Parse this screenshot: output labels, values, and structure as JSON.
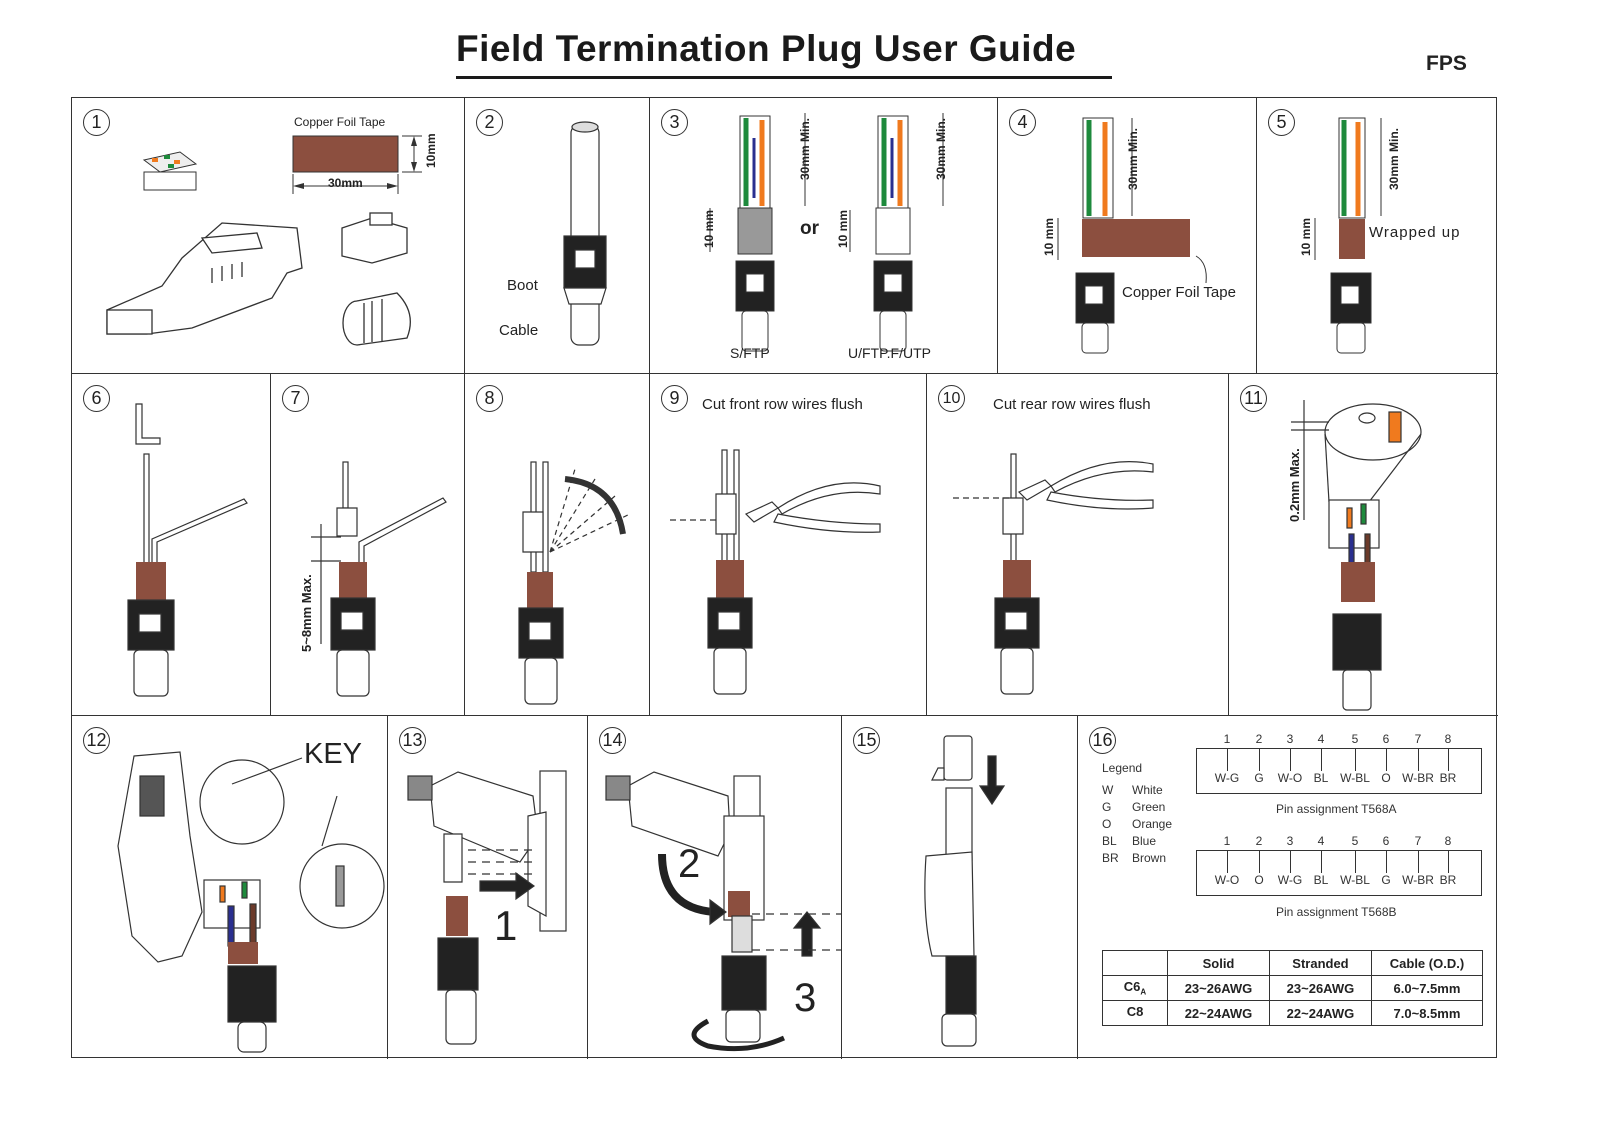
{
  "document": {
    "title": "Field Termination Plug User Guide",
    "model": "FPS"
  },
  "colors": {
    "copper_tape": "#8c4f3f",
    "wire_green": "#1e8a3c",
    "wire_orange": "#f07a1e",
    "wire_blue": "#2a2f8f",
    "wire_brown": "#6b3a2a",
    "line": "#333333"
  },
  "steps": [
    {
      "number": "1",
      "labels": {
        "tape_title": "Copper Foil Tape",
        "tape_width": "30mm",
        "tape_height": "10mm"
      }
    },
    {
      "number": "2",
      "labels": {
        "boot": "Boot",
        "cable": "Cable"
      }
    },
    {
      "number": "3",
      "labels": {
        "strip_length": "30mm Min.",
        "shield_length": "10 mm",
        "or": "or",
        "type_a": "S/FTP",
        "type_b": "U/FTP.F/UTP"
      }
    },
    {
      "number": "4",
      "labels": {
        "strip_length": "30mm Min.",
        "shield_length": "10 mm",
        "tape": "Copper Foil Tape"
      }
    },
    {
      "number": "5",
      "labels": {
        "strip_length": "30mm Min.",
        "shield_length": "10 mm",
        "note": "Wrapped up"
      }
    },
    {
      "number": "6"
    },
    {
      "number": "7",
      "labels": {
        "gap": "5~8mm Max."
      }
    },
    {
      "number": "8"
    },
    {
      "number": "9",
      "caption": "Cut front row wires flush"
    },
    {
      "number": "10",
      "caption": "Cut rear row wires flush"
    },
    {
      "number": "11",
      "labels": {
        "protrusion": "0.2mm Max."
      }
    },
    {
      "number": "12",
      "labels": {
        "key": "KEY"
      }
    },
    {
      "number": "13",
      "labels": {
        "action": "1"
      }
    },
    {
      "number": "14",
      "labels": {
        "action_a": "2",
        "action_b": "3"
      }
    },
    {
      "number": "15"
    },
    {
      "number": "16"
    }
  ],
  "legend": {
    "title": "Legend",
    "items": [
      {
        "code": "W",
        "name": "White"
      },
      {
        "code": "G",
        "name": "Green"
      },
      {
        "code": "O",
        "name": "Orange"
      },
      {
        "code": "BL",
        "name": "Blue"
      },
      {
        "code": "BR",
        "name": "Brown"
      }
    ]
  },
  "pin_assignments": [
    {
      "caption": "Pin assignment T568A",
      "pins": [
        "1",
        "2",
        "3",
        "4",
        "5",
        "6",
        "7",
        "8"
      ],
      "wires": [
        "W-G",
        "G",
        "W-O",
        "BL",
        "W-BL",
        "O",
        "W-BR",
        "BR"
      ]
    },
    {
      "caption": "Pin assignment T568B",
      "pins": [
        "1",
        "2",
        "3",
        "4",
        "5",
        "6",
        "7",
        "8"
      ],
      "wires": [
        "W-O",
        "O",
        "W-G",
        "BL",
        "W-BL",
        "G",
        "W-BR",
        "BR"
      ]
    }
  ],
  "spec_table": {
    "headers": [
      "",
      "Solid",
      "Stranded",
      "Cable (O.D.)"
    ],
    "rows": [
      {
        "type": "C6",
        "type_sub": "A",
        "solid": "23~26AWG",
        "stranded": "23~26AWG",
        "cable_od": "6.0~7.5mm"
      },
      {
        "type": "C8",
        "type_sub": "",
        "solid": "22~24AWG",
        "stranded": "22~24AWG",
        "cable_od": "7.0~8.5mm"
      }
    ]
  }
}
